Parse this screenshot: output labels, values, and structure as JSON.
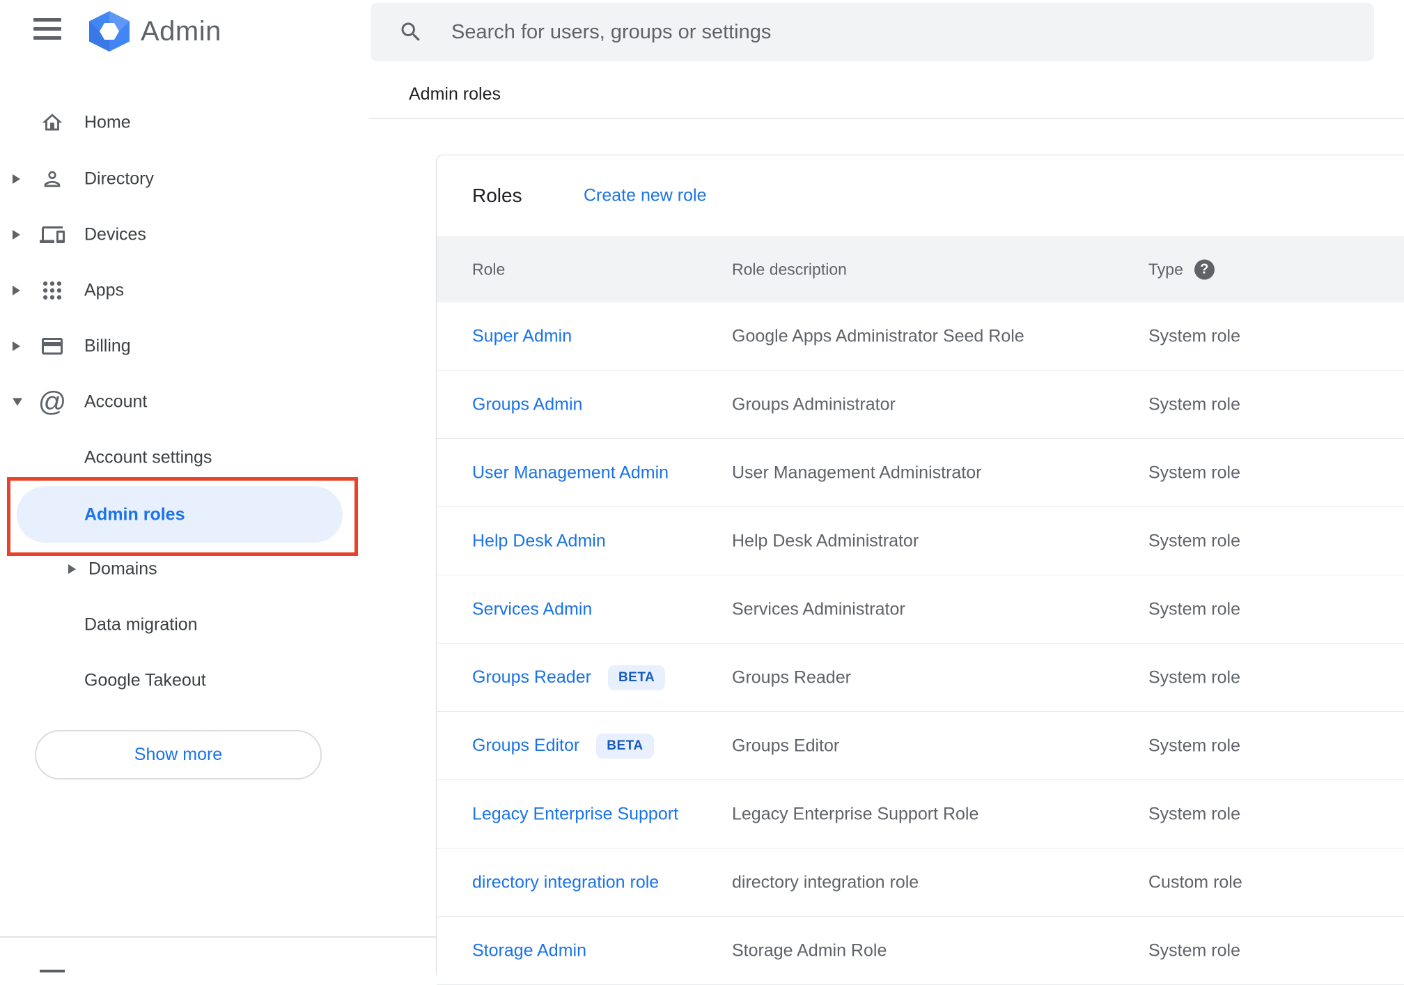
{
  "app": {
    "title": "Admin"
  },
  "sidebar": {
    "items": [
      {
        "label": "Home"
      },
      {
        "label": "Directory"
      },
      {
        "label": "Devices"
      },
      {
        "label": "Apps"
      },
      {
        "label": "Billing"
      },
      {
        "label": "Account"
      }
    ],
    "account_children": [
      {
        "label": "Account settings"
      },
      {
        "label": "Admin roles"
      },
      {
        "label": "Domains"
      },
      {
        "label": "Data migration"
      },
      {
        "label": "Google Takeout"
      }
    ],
    "show_more_label": "Show more"
  },
  "search": {
    "placeholder": "Search for users, groups or settings"
  },
  "breadcrumb": "Admin roles",
  "roles_card": {
    "title": "Roles",
    "create_link": "Create new role",
    "columns": {
      "role": "Role",
      "description": "Role description",
      "type": "Type"
    },
    "beta_label": "BETA",
    "rows": [
      {
        "role": "Super Admin",
        "description": "Google Apps Administrator Seed Role",
        "type": "System role",
        "beta": false
      },
      {
        "role": "Groups Admin",
        "description": "Groups Administrator",
        "type": "System role",
        "beta": false
      },
      {
        "role": "User Management Admin",
        "description": "User Management Administrator",
        "type": "System role",
        "beta": false
      },
      {
        "role": "Help Desk Admin",
        "description": "Help Desk Administrator",
        "type": "System role",
        "beta": false
      },
      {
        "role": "Services Admin",
        "description": "Services Administrator",
        "type": "System role",
        "beta": false
      },
      {
        "role": "Groups Reader",
        "description": "Groups Reader",
        "type": "System role",
        "beta": true
      },
      {
        "role": "Groups Editor",
        "description": "Groups Editor",
        "type": "System role",
        "beta": true
      },
      {
        "role": "Legacy Enterprise Support",
        "description": "Legacy Enterprise Support Role",
        "type": "System role",
        "beta": false
      },
      {
        "role": "directory integration role",
        "description": "directory integration role",
        "type": "Custom role",
        "beta": false
      },
      {
        "role": "Storage Admin",
        "description": "Storage Admin Role",
        "type": "System role",
        "beta": false
      }
    ]
  },
  "colors": {
    "link_blue": "#1a73e8",
    "active_item_bg": "#e8f0fe",
    "beta_text": "#185abc",
    "annotation_red": "#e8432a",
    "table_header_bg": "#f1f3f4",
    "text_dark": "#202124",
    "text_gray": "#5f6368"
  }
}
